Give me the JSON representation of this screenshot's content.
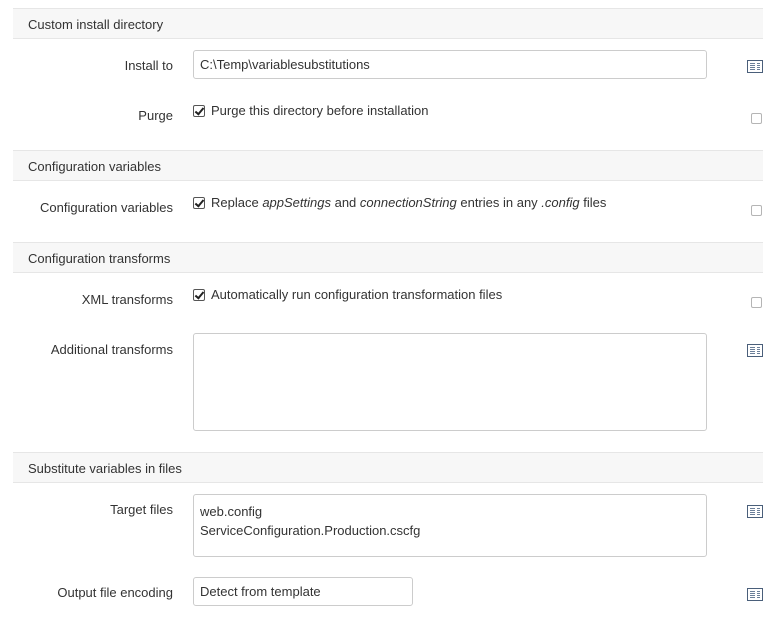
{
  "sections": {
    "install_dir": {
      "title": "Custom install directory"
    },
    "config_vars": {
      "title": "Configuration variables"
    },
    "config_transforms": {
      "title": "Configuration transforms"
    },
    "substitute": {
      "title": "Substitute variables in files"
    }
  },
  "install_to": {
    "label": "Install to",
    "value": "C:\\Temp\\variablesubstitutions"
  },
  "purge": {
    "label": "Purge",
    "checkbox_text": "Purge this directory before installation",
    "checked": true
  },
  "configuration_variables": {
    "label": "Configuration variables",
    "text_1": "Replace ",
    "text_app_settings": "appSettings",
    "text_2": " and ",
    "text_connection_string": "connectionString",
    "text_3": " entries in any ",
    "text_config": ".config",
    "text_4": " files",
    "checked": true
  },
  "xml_transforms": {
    "label": "XML transforms",
    "checkbox_text": "Automatically run configuration transformation files",
    "checked": true
  },
  "additional_transforms": {
    "label": "Additional transforms",
    "value": ""
  },
  "target_files": {
    "label": "Target files",
    "lines": [
      "web.config",
      "ServiceConfiguration.Production.cscfg"
    ]
  },
  "output_encoding": {
    "label": "Output file encoding",
    "value": "Detect from template"
  },
  "icons": {
    "variable_picker": "variable-picker-icon"
  }
}
